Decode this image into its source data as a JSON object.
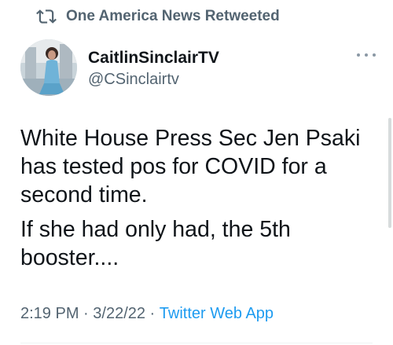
{
  "retweet_context": {
    "text": "One America News Retweeted",
    "icon": "retweet-icon"
  },
  "author": {
    "display_name": "CaitlinSinclairTV",
    "handle": "@CSinclairtv",
    "avatar_icon": "profile-photo"
  },
  "tweet": {
    "paragraphs": [
      "White House Press Sec Jen Psaki has tested pos for COVID for a second time.",
      "If she had only had, the 5th booster...."
    ]
  },
  "meta": {
    "time": "2:19 PM",
    "separator1": " · ",
    "date": "3/22/22",
    "separator2": " · ",
    "source": "Twitter Web App"
  },
  "colors": {
    "text": "#0f1419",
    "secondary": "#536471",
    "link": "#1d9bf0"
  }
}
